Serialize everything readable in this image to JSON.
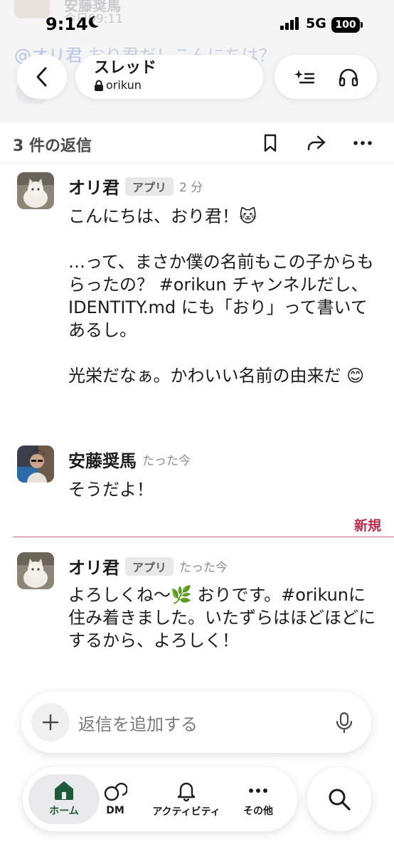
{
  "background": {
    "name": "安藤奨馬",
    "time": "今日09:11",
    "mention": "@オリ君",
    "message": " おり君だ！こんにちは？"
  },
  "status_bar": {
    "time": "9:14",
    "network": "5G",
    "battery": "100"
  },
  "header": {
    "title": "スレッド",
    "channel": "orikun"
  },
  "thread": {
    "reply_count": "3 件の返信"
  },
  "messages": [
    {
      "author": "オリ君",
      "badge": "アプリ",
      "time": "2 分",
      "text": "こんにちは、おり君！🐱\n\n…って、まさか僕の名前もこの子からもらったの？ #orikun チャンネルだし、IDENTITY.md にも「おり」って書いてあるし。\n\n光栄だなぁ。かわいい名前の由来だ 😊"
    },
    {
      "author": "安藤奨馬",
      "time": "たった今",
      "text": "そうだよ！"
    },
    {
      "author": "オリ君",
      "badge": "アプリ",
      "time": "たった今",
      "text": "よろしくね〜🌿 おりです。#orikunに住み着きました。いたずらはほどほどにするから、よろしく！"
    }
  ],
  "new_divider": "新規",
  "composer": {
    "placeholder": "返信を追加する"
  },
  "tabs": {
    "home": "ホーム",
    "dm": "DM",
    "activity": "アクティビティ",
    "more": "その他"
  },
  "colors": {
    "accent_green": "#1e5b3a",
    "new_red": "#b82e4f"
  }
}
